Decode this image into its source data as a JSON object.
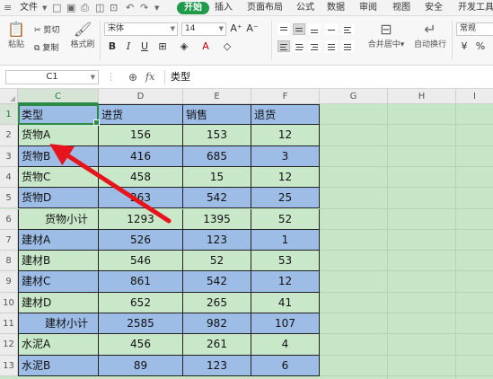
{
  "menu": {
    "file": "文件",
    "tabs": [
      "开始",
      "插入",
      "页面布局",
      "公式",
      "数据",
      "审阅",
      "视图",
      "安全",
      "开发工具"
    ]
  },
  "ribbon": {
    "paste": "粘贴",
    "cut": "剪切",
    "copy": "复制",
    "format_painter": "格式刷",
    "font_name": "宋体",
    "font_size": "14",
    "merge_center": "合并居中",
    "wrap_text": "自动换行",
    "number_format": "常规"
  },
  "formula_bar": {
    "cell_ref": "C1",
    "fx": "fx",
    "value": "类型"
  },
  "columns": [
    "C",
    "D",
    "E",
    "F",
    "G",
    "H",
    "I"
  ],
  "rows": [
    {
      "n": "1",
      "c": "类型",
      "d": "进货",
      "e": "销售",
      "f": "退货"
    },
    {
      "n": "2",
      "c": "货物A",
      "d": "156",
      "e": "153",
      "f": "12"
    },
    {
      "n": "3",
      "c": "货物B",
      "d": "416",
      "e": "685",
      "f": "3"
    },
    {
      "n": "4",
      "c": "货物C",
      "d": "458",
      "e": "15",
      "f": "12"
    },
    {
      "n": "5",
      "c": "货物D",
      "d": "263",
      "e": "542",
      "f": "25"
    },
    {
      "n": "6",
      "c": "货物小计",
      "d": "1293",
      "e": "1395",
      "f": "52"
    },
    {
      "n": "7",
      "c": "建材A",
      "d": "526",
      "e": "123",
      "f": "1"
    },
    {
      "n": "8",
      "c": "建材B",
      "d": "546",
      "e": "52",
      "f": "53"
    },
    {
      "n": "9",
      "c": "建材C",
      "d": "861",
      "e": "542",
      "f": "12"
    },
    {
      "n": "10",
      "c": "建材D",
      "d": "652",
      "e": "265",
      "f": "41"
    },
    {
      "n": "11",
      "c": "建材小计",
      "d": "2585",
      "e": "982",
      "f": "107"
    },
    {
      "n": "12",
      "c": "水泥A",
      "d": "456",
      "e": "261",
      "f": "4"
    },
    {
      "n": "13",
      "c": "水泥B",
      "d": "89",
      "e": "123",
      "f": "6"
    }
  ],
  "colors": {
    "band_green": "#c9e8c9",
    "band_blue": "#9dbde6",
    "accent": "#1f9a49",
    "arrow": "#e8141b"
  }
}
